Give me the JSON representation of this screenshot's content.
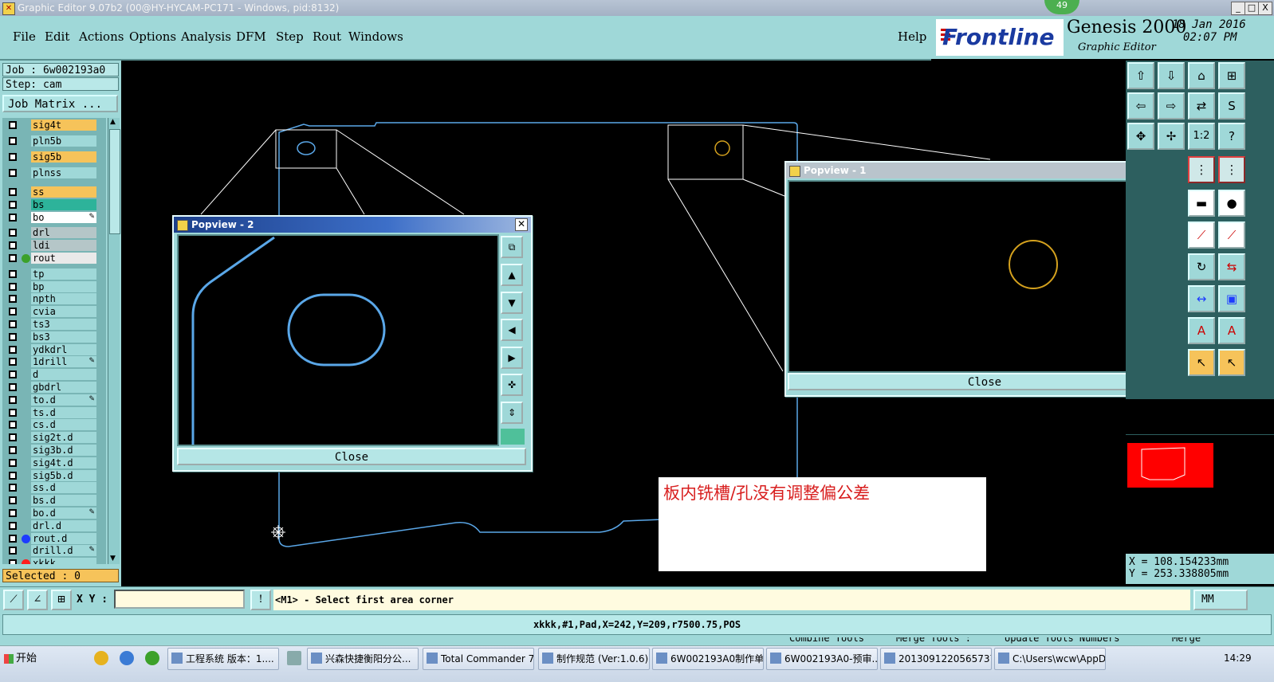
{
  "window": {
    "title": "Graphic Editor 9.07b2 (00@HY-HYCAM-PC171 - Windows, pid:8132)",
    "badge": "49",
    "buttons": [
      "_",
      "□",
      "X"
    ]
  },
  "menu": {
    "items": [
      "File",
      "Edit",
      "Actions",
      "Options",
      "Analysis",
      "DFM",
      "Step",
      "Rout",
      "Windows"
    ],
    "help": "Help"
  },
  "brand": {
    "logo": "Frontline",
    "product": "Genesis 2000",
    "subtitle": "Graphic Editor",
    "date": "18 Jan 2016",
    "time": "02:07 PM"
  },
  "left": {
    "job": "Job : 6w002193a0",
    "step": "Step: cam",
    "job_matrix": "Job Matrix ...",
    "selected": "Selected : 0",
    "layers": [
      {
        "name": "sig4t",
        "color": "#f6c35a",
        "dot": ""
      },
      {
        "name": "pln5b",
        "color": "#9fd8d8",
        "dot": ""
      },
      {
        "name": "sig5b",
        "color": "#f6c35a",
        "dot": ""
      },
      {
        "name": "plnss",
        "color": "#9fd8d8",
        "dot": ""
      },
      {
        "name": "ss",
        "color": "#f6c35a",
        "dot": ""
      },
      {
        "name": "bs",
        "color": "#2db39a",
        "dot": ""
      },
      {
        "name": "bo",
        "color": "#ffffff",
        "dot": "",
        "edit": "✎"
      },
      {
        "name": "drl",
        "color": "#b5c6c8",
        "dot": ""
      },
      {
        "name": "ldi",
        "color": "#b5c6c8",
        "dot": ""
      },
      {
        "name": "rout",
        "color": "#e9e9e9",
        "dot": "#3ca12a"
      },
      {
        "name": "tp",
        "color": "#9fd8d8",
        "dot": ""
      },
      {
        "name": "bp",
        "color": "#9fd8d8",
        "dot": ""
      },
      {
        "name": "npth",
        "color": "#9fd8d8",
        "dot": ""
      },
      {
        "name": "cvia",
        "color": "#9fd8d8",
        "dot": ""
      },
      {
        "name": "ts3",
        "color": "#9fd8d8",
        "dot": ""
      },
      {
        "name": "bs3",
        "color": "#9fd8d8",
        "dot": ""
      },
      {
        "name": "ydkdrl",
        "color": "#9fd8d8",
        "dot": ""
      },
      {
        "name": "1drill",
        "color": "#9fd8d8",
        "dot": "",
        "edit": "✎"
      },
      {
        "name": "d",
        "color": "#9fd8d8",
        "dot": ""
      },
      {
        "name": "gbdrl",
        "color": "#9fd8d8",
        "dot": ""
      },
      {
        "name": "to.d",
        "color": "#9fd8d8",
        "dot": "",
        "edit": "✎"
      },
      {
        "name": "ts.d",
        "color": "#9fd8d8",
        "dot": ""
      },
      {
        "name": "cs.d",
        "color": "#9fd8d8",
        "dot": ""
      },
      {
        "name": "sig2t.d",
        "color": "#9fd8d8",
        "dot": ""
      },
      {
        "name": "sig3b.d",
        "color": "#9fd8d8",
        "dot": ""
      },
      {
        "name": "sig4t.d",
        "color": "#9fd8d8",
        "dot": ""
      },
      {
        "name": "sig5b.d",
        "color": "#9fd8d8",
        "dot": ""
      },
      {
        "name": "ss.d",
        "color": "#9fd8d8",
        "dot": ""
      },
      {
        "name": "bs.d",
        "color": "#9fd8d8",
        "dot": ""
      },
      {
        "name": "bo.d",
        "color": "#9fd8d8",
        "dot": "",
        "edit": "✎"
      },
      {
        "name": "drl.d",
        "color": "#9fd8d8",
        "dot": ""
      },
      {
        "name": "rout.d",
        "color": "#9fd8d8",
        "dot": "#1e3cff"
      },
      {
        "name": "drill.d",
        "color": "#9fd8d8",
        "dot": "",
        "edit": "✎"
      },
      {
        "name": "xkkk",
        "color": "#9fd8d8",
        "dot": "#ff1e1e"
      }
    ]
  },
  "popview2": {
    "title": "Popview - 2",
    "close": "Close"
  },
  "popview1": {
    "title": "Popview - 1",
    "close": "Close"
  },
  "annotation": "板内铣槽/孔没有调整偏公差",
  "coords": {
    "x": "X = 108.154233mm",
    "y": "Y = 253.338805mm"
  },
  "command": {
    "xy_label": "X Y :",
    "xy_value": "",
    "prompt": "<M1> - Select first area corner",
    "units": "MM"
  },
  "status": "xkkk,#1,Pad,X=242,Y=209,r7500.75,POS",
  "hidden_strip": [
    "Combine Tools",
    "Merge Tools :",
    "Update Tools Numbers",
    "Merge"
  ],
  "taskbar": {
    "start": "开始",
    "tasks": [
      "工程系统  版本：1....",
      "兴森快捷衡阳分公...",
      "Total Commander 7.0...",
      "制作规范 (Ver:1.0.6)",
      "6W002193A0制作单...",
      "6W002193A0-预审...",
      "20130912205657375...",
      "C:\\Users\\wcw\\AppDa..."
    ],
    "clock": "14:29"
  },
  "colors": {
    "panel": "#9fd8d8",
    "canvas": "#000000",
    "profile": "#5aa7e8",
    "hole": "#d4a11e",
    "annotation_text": "#d81e1e"
  }
}
